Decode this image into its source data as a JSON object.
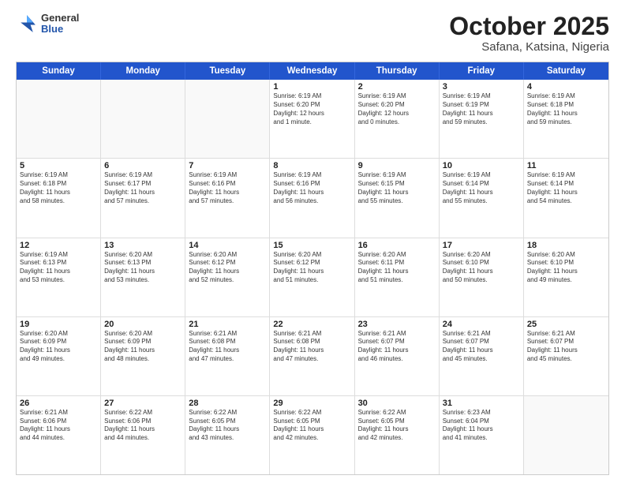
{
  "header": {
    "logo": {
      "general": "General",
      "blue": "Blue"
    },
    "title": "October 2025",
    "subtitle": "Safana, Katsina, Nigeria"
  },
  "calendar": {
    "days": [
      "Sunday",
      "Monday",
      "Tuesday",
      "Wednesday",
      "Thursday",
      "Friday",
      "Saturday"
    ],
    "rows": [
      [
        {
          "day": "",
          "info": "",
          "empty": true
        },
        {
          "day": "",
          "info": "",
          "empty": true
        },
        {
          "day": "",
          "info": "",
          "empty": true
        },
        {
          "day": "1",
          "info": "Sunrise: 6:19 AM\nSunset: 6:20 PM\nDaylight: 12 hours\nand 1 minute."
        },
        {
          "day": "2",
          "info": "Sunrise: 6:19 AM\nSunset: 6:20 PM\nDaylight: 12 hours\nand 0 minutes."
        },
        {
          "day": "3",
          "info": "Sunrise: 6:19 AM\nSunset: 6:19 PM\nDaylight: 11 hours\nand 59 minutes."
        },
        {
          "day": "4",
          "info": "Sunrise: 6:19 AM\nSunset: 6:18 PM\nDaylight: 11 hours\nand 59 minutes."
        }
      ],
      [
        {
          "day": "5",
          "info": "Sunrise: 6:19 AM\nSunset: 6:18 PM\nDaylight: 11 hours\nand 58 minutes."
        },
        {
          "day": "6",
          "info": "Sunrise: 6:19 AM\nSunset: 6:17 PM\nDaylight: 11 hours\nand 57 minutes."
        },
        {
          "day": "7",
          "info": "Sunrise: 6:19 AM\nSunset: 6:16 PM\nDaylight: 11 hours\nand 57 minutes."
        },
        {
          "day": "8",
          "info": "Sunrise: 6:19 AM\nSunset: 6:16 PM\nDaylight: 11 hours\nand 56 minutes."
        },
        {
          "day": "9",
          "info": "Sunrise: 6:19 AM\nSunset: 6:15 PM\nDaylight: 11 hours\nand 55 minutes."
        },
        {
          "day": "10",
          "info": "Sunrise: 6:19 AM\nSunset: 6:14 PM\nDaylight: 11 hours\nand 55 minutes."
        },
        {
          "day": "11",
          "info": "Sunrise: 6:19 AM\nSunset: 6:14 PM\nDaylight: 11 hours\nand 54 minutes."
        }
      ],
      [
        {
          "day": "12",
          "info": "Sunrise: 6:19 AM\nSunset: 6:13 PM\nDaylight: 11 hours\nand 53 minutes."
        },
        {
          "day": "13",
          "info": "Sunrise: 6:20 AM\nSunset: 6:13 PM\nDaylight: 11 hours\nand 53 minutes."
        },
        {
          "day": "14",
          "info": "Sunrise: 6:20 AM\nSunset: 6:12 PM\nDaylight: 11 hours\nand 52 minutes."
        },
        {
          "day": "15",
          "info": "Sunrise: 6:20 AM\nSunset: 6:12 PM\nDaylight: 11 hours\nand 51 minutes."
        },
        {
          "day": "16",
          "info": "Sunrise: 6:20 AM\nSunset: 6:11 PM\nDaylight: 11 hours\nand 51 minutes."
        },
        {
          "day": "17",
          "info": "Sunrise: 6:20 AM\nSunset: 6:10 PM\nDaylight: 11 hours\nand 50 minutes."
        },
        {
          "day": "18",
          "info": "Sunrise: 6:20 AM\nSunset: 6:10 PM\nDaylight: 11 hours\nand 49 minutes."
        }
      ],
      [
        {
          "day": "19",
          "info": "Sunrise: 6:20 AM\nSunset: 6:09 PM\nDaylight: 11 hours\nand 49 minutes."
        },
        {
          "day": "20",
          "info": "Sunrise: 6:20 AM\nSunset: 6:09 PM\nDaylight: 11 hours\nand 48 minutes."
        },
        {
          "day": "21",
          "info": "Sunrise: 6:21 AM\nSunset: 6:08 PM\nDaylight: 11 hours\nand 47 minutes."
        },
        {
          "day": "22",
          "info": "Sunrise: 6:21 AM\nSunset: 6:08 PM\nDaylight: 11 hours\nand 47 minutes."
        },
        {
          "day": "23",
          "info": "Sunrise: 6:21 AM\nSunset: 6:07 PM\nDaylight: 11 hours\nand 46 minutes."
        },
        {
          "day": "24",
          "info": "Sunrise: 6:21 AM\nSunset: 6:07 PM\nDaylight: 11 hours\nand 45 minutes."
        },
        {
          "day": "25",
          "info": "Sunrise: 6:21 AM\nSunset: 6:07 PM\nDaylight: 11 hours\nand 45 minutes."
        }
      ],
      [
        {
          "day": "26",
          "info": "Sunrise: 6:21 AM\nSunset: 6:06 PM\nDaylight: 11 hours\nand 44 minutes."
        },
        {
          "day": "27",
          "info": "Sunrise: 6:22 AM\nSunset: 6:06 PM\nDaylight: 11 hours\nand 44 minutes."
        },
        {
          "day": "28",
          "info": "Sunrise: 6:22 AM\nSunset: 6:05 PM\nDaylight: 11 hours\nand 43 minutes."
        },
        {
          "day": "29",
          "info": "Sunrise: 6:22 AM\nSunset: 6:05 PM\nDaylight: 11 hours\nand 42 minutes."
        },
        {
          "day": "30",
          "info": "Sunrise: 6:22 AM\nSunset: 6:05 PM\nDaylight: 11 hours\nand 42 minutes."
        },
        {
          "day": "31",
          "info": "Sunrise: 6:23 AM\nSunset: 6:04 PM\nDaylight: 11 hours\nand 41 minutes."
        },
        {
          "day": "",
          "info": "",
          "empty": true
        }
      ]
    ]
  }
}
